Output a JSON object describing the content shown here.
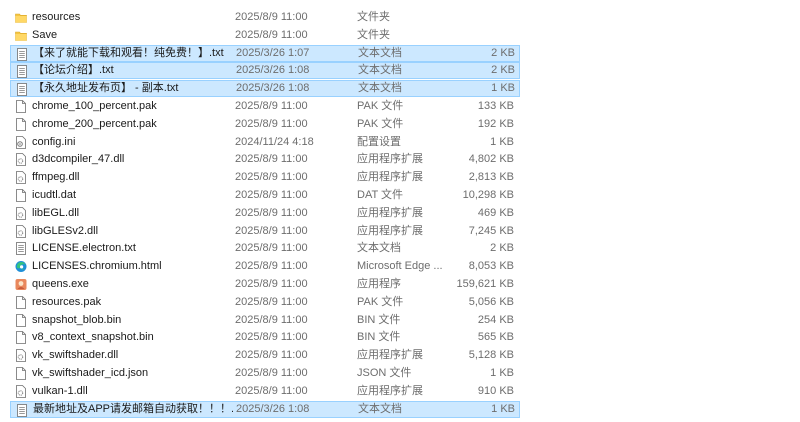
{
  "files": [
    {
      "name": "resources",
      "date": "2025/8/9 11:00",
      "type": "文件夹",
      "size": "",
      "icon": "folder",
      "selected": false
    },
    {
      "name": "Save",
      "date": "2025/8/9 11:00",
      "type": "文件夹",
      "size": "",
      "icon": "folder",
      "selected": false
    },
    {
      "name": "【来了就能下载和观看！纯免费！】.txt",
      "date": "2025/3/26 1:07",
      "type": "文本文档",
      "size": "2 KB",
      "icon": "text",
      "selected": true
    },
    {
      "name": "【论坛介绍】.txt",
      "date": "2025/3/26 1:08",
      "type": "文本文档",
      "size": "2 KB",
      "icon": "text",
      "selected": true
    },
    {
      "name": "【永久地址发布页】 - 副本.txt",
      "date": "2025/3/26 1:08",
      "type": "文本文档",
      "size": "1 KB",
      "icon": "text",
      "selected": true
    },
    {
      "name": "chrome_100_percent.pak",
      "date": "2025/8/9 11:00",
      "type": "PAK 文件",
      "size": "133 KB",
      "icon": "file",
      "selected": false
    },
    {
      "name": "chrome_200_percent.pak",
      "date": "2025/8/9 11:00",
      "type": "PAK 文件",
      "size": "192 KB",
      "icon": "file",
      "selected": false
    },
    {
      "name": "config.ini",
      "date": "2024/11/24 4:18",
      "type": "配置设置",
      "size": "1 KB",
      "icon": "config",
      "selected": false
    },
    {
      "name": "d3dcompiler_47.dll",
      "date": "2025/8/9 11:00",
      "type": "应用程序扩展",
      "size": "4,802 KB",
      "icon": "dll",
      "selected": false
    },
    {
      "name": "ffmpeg.dll",
      "date": "2025/8/9 11:00",
      "type": "应用程序扩展",
      "size": "2,813 KB",
      "icon": "dll",
      "selected": false
    },
    {
      "name": "icudtl.dat",
      "date": "2025/8/9 11:00",
      "type": "DAT 文件",
      "size": "10,298 KB",
      "icon": "file",
      "selected": false
    },
    {
      "name": "libEGL.dll",
      "date": "2025/8/9 11:00",
      "type": "应用程序扩展",
      "size": "469 KB",
      "icon": "dll",
      "selected": false
    },
    {
      "name": "libGLESv2.dll",
      "date": "2025/8/9 11:00",
      "type": "应用程序扩展",
      "size": "7,245 KB",
      "icon": "dll",
      "selected": false
    },
    {
      "name": "LICENSE.electron.txt",
      "date": "2025/8/9 11:00",
      "type": "文本文档",
      "size": "2 KB",
      "icon": "text",
      "selected": false
    },
    {
      "name": "LICENSES.chromium.html",
      "date": "2025/8/9 11:00",
      "type": "Microsoft Edge ...",
      "size": "8,053 KB",
      "icon": "edge",
      "selected": false
    },
    {
      "name": "queens.exe",
      "date": "2025/8/9 11:00",
      "type": "应用程序",
      "size": "159,621 KB",
      "icon": "exe",
      "selected": false
    },
    {
      "name": "resources.pak",
      "date": "2025/8/9 11:00",
      "type": "PAK 文件",
      "size": "5,056 KB",
      "icon": "file",
      "selected": false
    },
    {
      "name": "snapshot_blob.bin",
      "date": "2025/8/9 11:00",
      "type": "BIN 文件",
      "size": "254 KB",
      "icon": "file",
      "selected": false
    },
    {
      "name": "v8_context_snapshot.bin",
      "date": "2025/8/9 11:00",
      "type": "BIN 文件",
      "size": "565 KB",
      "icon": "file",
      "selected": false
    },
    {
      "name": "vk_swiftshader.dll",
      "date": "2025/8/9 11:00",
      "type": "应用程序扩展",
      "size": "5,128 KB",
      "icon": "dll",
      "selected": false
    },
    {
      "name": "vk_swiftshader_icd.json",
      "date": "2025/8/9 11:00",
      "type": "JSON 文件",
      "size": "1 KB",
      "icon": "file",
      "selected": false
    },
    {
      "name": "vulkan-1.dll",
      "date": "2025/8/9 11:00",
      "type": "应用程序扩展",
      "size": "910 KB",
      "icon": "dll",
      "selected": false
    },
    {
      "name": "最新地址及APP请发邮箱自动获取！！！....",
      "date": "2025/3/26 1:08",
      "type": "文本文档",
      "size": "1 KB",
      "icon": "text",
      "selected": true
    }
  ],
  "colors": {
    "selection_bg": "#cce8ff",
    "selection_border": "#99d1ff",
    "folder": "#f4c542",
    "secondary_text": "#6d6d6d"
  }
}
